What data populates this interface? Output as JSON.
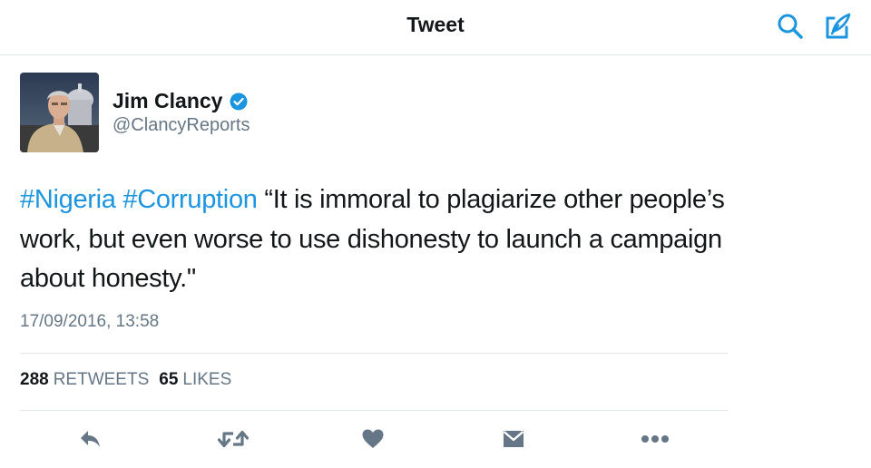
{
  "header": {
    "title": "Tweet",
    "search_icon": "search-icon",
    "compose_icon": "compose-icon",
    "accent_color": "#1b95e0"
  },
  "tweet": {
    "author": {
      "name": "Jim Clancy",
      "handle": "@ClancyReports",
      "verified": true,
      "avatar_icon": "user-avatar"
    },
    "hashtags": [
      "#Nigeria",
      "#Corruption"
    ],
    "text": "“It is immoral to plagiarize other people’s work, but even worse to use dishonesty to launch a campaign about honesty.\"",
    "timestamp": "17/09/2016, 13:58",
    "stats": {
      "retweets_count": "288",
      "retweets_label": "RETWEETS",
      "likes_count": "65",
      "likes_label": "LIKES"
    },
    "actions": [
      "reply-icon",
      "retweet-icon",
      "like-icon",
      "direct-message-icon",
      "more-icon"
    ]
  }
}
